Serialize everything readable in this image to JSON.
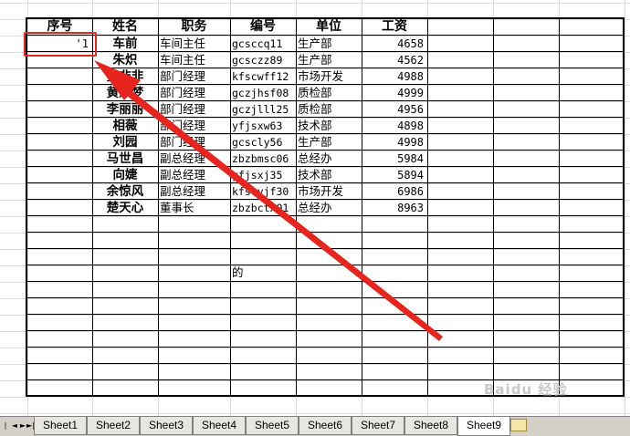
{
  "headers": [
    "序号",
    "姓名",
    "职务",
    "编号",
    "单位",
    "工资"
  ],
  "rows": [
    {
      "seq": "'1",
      "name": "车前",
      "title": "车间主任",
      "code": "gcsccq11",
      "unit": "生产部",
      "salary": "4658"
    },
    {
      "seq": "",
      "name": "朱炽",
      "title": "车间主任",
      "code": "gcsczz89",
      "unit": "生产部",
      "salary": "4562"
    },
    {
      "seq": "",
      "name": "吴非非",
      "title": "部门经理",
      "code": "kfscwff12",
      "unit": "市场开发",
      "salary": "4988"
    },
    {
      "seq": "",
      "name": "黄淑梦",
      "title": "部门经理",
      "code": "gczjhsf08",
      "unit": "质检部",
      "salary": "4999"
    },
    {
      "seq": "",
      "name": "李丽丽",
      "title": "部门经理",
      "code": "gczjlll25",
      "unit": "质检部",
      "salary": "4956"
    },
    {
      "seq": "",
      "name": "相薇",
      "title": "部门经理",
      "code": "yfjsxw63",
      "unit": "技术部",
      "salary": "4898"
    },
    {
      "seq": "",
      "name": "刘园",
      "title": "部门经理",
      "code": "gcscly56",
      "unit": "生产部",
      "salary": "4998"
    },
    {
      "seq": "",
      "name": "马世昌",
      "title": "副总经理",
      "code": "zbzbmsc06",
      "unit": "总经办",
      "salary": "5984"
    },
    {
      "seq": "",
      "name": "向婕",
      "title": "副总经理",
      "code": "yfjsxj35",
      "unit": "技术部",
      "salary": "5894"
    },
    {
      "seq": "",
      "name": "余惊风",
      "title": "副总经理",
      "code": "kfscyjf30",
      "unit": "市场开发",
      "salary": "6986"
    },
    {
      "seq": "",
      "name": "楚天心",
      "title": "董事长",
      "code": "zbzbctx01",
      "unit": "总经办",
      "salary": "8963"
    }
  ],
  "extra_cell": "的",
  "sheet_tabs": [
    "Sheet1",
    "Sheet2",
    "Sheet3",
    "Sheet4",
    "Sheet5",
    "Sheet6",
    "Sheet7",
    "Sheet8",
    "Sheet9"
  ],
  "active_tab": "Sheet9",
  "watermark": "Baidu 经验",
  "annotation_color": "#e8241e"
}
